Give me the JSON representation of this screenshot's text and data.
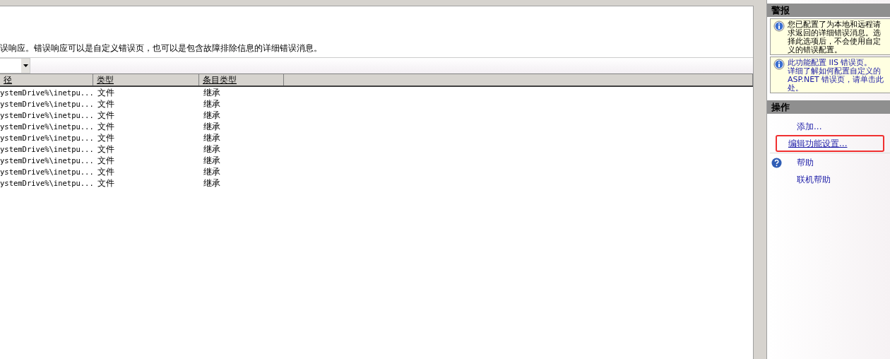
{
  "description": "误响应。错误响应可以是自定义错误页，也可以是包含故障排除信息的详细错误消息。",
  "table": {
    "columns": [
      "径",
      "类型",
      "条目类型"
    ],
    "rows": [
      [
        "ystemDrive%\\inetpu...",
        "文件",
        "继承"
      ],
      [
        "ystemDrive%\\inetpu...",
        "文件",
        "继承"
      ],
      [
        "ystemDrive%\\inetpu...",
        "文件",
        "继承"
      ],
      [
        "ystemDrive%\\inetpu...",
        "文件",
        "继承"
      ],
      [
        "ystemDrive%\\inetpu...",
        "文件",
        "继承"
      ],
      [
        "ystemDrive%\\inetpu...",
        "文件",
        "继承"
      ],
      [
        "ystemDrive%\\inetpu...",
        "文件",
        "继承"
      ],
      [
        "ystemDrive%\\inetpu...",
        "文件",
        "继承"
      ],
      [
        "ystemDrive%\\inetpu...",
        "文件",
        "继承"
      ]
    ]
  },
  "alerts": {
    "title": "警报",
    "items": [
      {
        "kind": "text",
        "lines": [
          "您已配置了为本地和远程请",
          "求返回的详细错误消息。选",
          "择此选项后，不会使用自定",
          "义的错误配置。"
        ]
      },
      {
        "kind": "link",
        "lines": [
          "此功能配置 IIS 错误页。",
          "详细了解如何配置自定义的",
          "ASP.NET 错误页，请单击此",
          "处。"
        ]
      }
    ]
  },
  "actions": {
    "title": "操作",
    "groups": [
      [
        {
          "kind": "plain",
          "label": "添加...",
          "highlighted": false
        },
        {
          "kind": "plain",
          "label": "编辑功能设置...",
          "highlighted": true
        }
      ],
      [
        {
          "kind": "help",
          "label": "帮助",
          "highlighted": false
        },
        {
          "kind": "plain",
          "label": "联机帮助",
          "highlighted": false
        }
      ]
    ]
  }
}
